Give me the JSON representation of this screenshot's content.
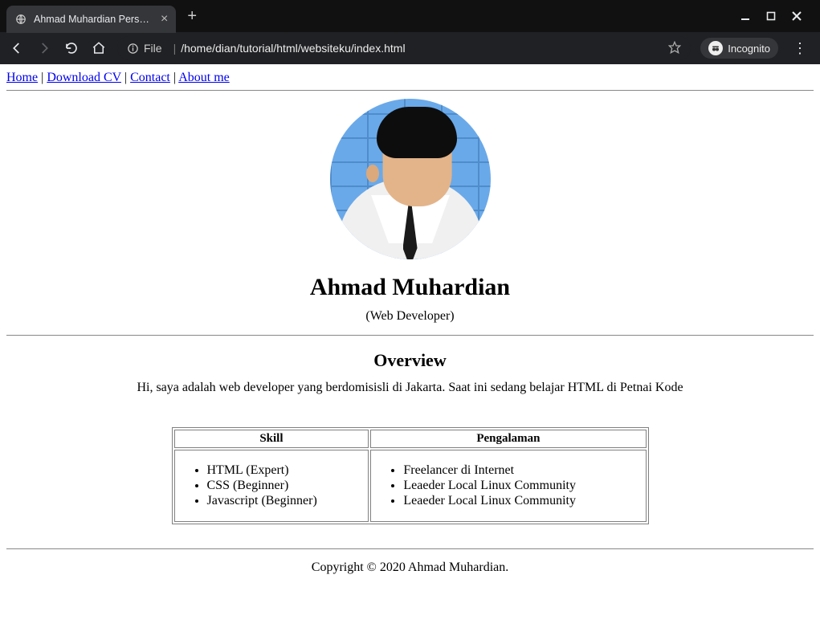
{
  "browser": {
    "tab_title": "Ahmad Muhardian Personal W",
    "url_scheme_label": "File",
    "url_path": "/home/dian/tutorial/html/websiteku/index.html",
    "incognito_label": "Incognito"
  },
  "nav": {
    "home": "Home",
    "download_cv": "Download CV",
    "contact": "Contact",
    "about_me": "About me",
    "sep": " | "
  },
  "header": {
    "name": "Ahmad Muhardian",
    "role": "(Web Developer)"
  },
  "main": {
    "overview_heading": "Overview",
    "overview_text": "Hi, saya adalah web developer yang berdomisisli di Jakarta. Saat ini sedang belajar HTML di Petnai Kode",
    "table": {
      "col1": "Skill",
      "col2": "Pengalaman",
      "skills": {
        "0": "HTML (Expert)",
        "1": "CSS (Beginner)",
        "2": "Javascript (Beginner)"
      },
      "experience": {
        "0": "Freelancer di Internet",
        "1": "Leaeder Local Linux Community",
        "2": "Leaeder Local Linux Community"
      }
    }
  },
  "footer": {
    "text": "Copyright © 2020 Ahmad Muhardian."
  }
}
